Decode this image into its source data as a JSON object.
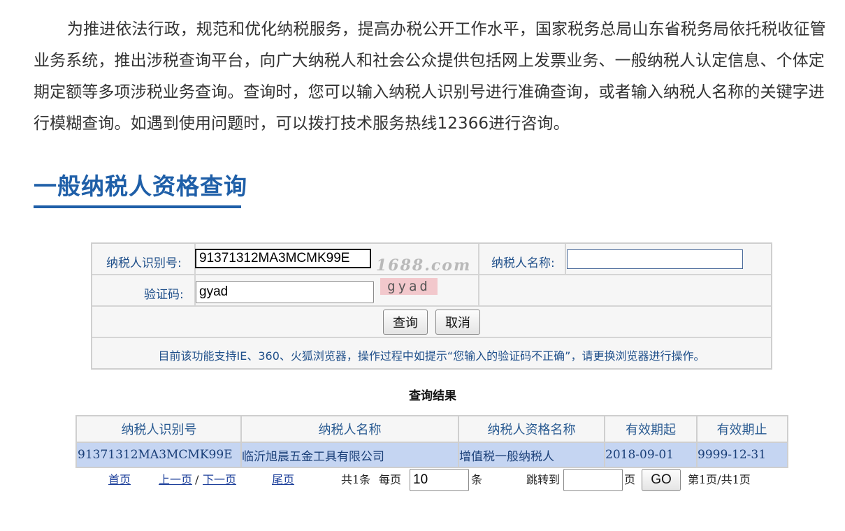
{
  "intro": {
    "paragraph": "为推进依法行政，规范和优化纳税服务，提高办税公开工作水平，国家税务总局山东省税务局依托税收征管业务系统，推出涉税查询平台，向广大纳税人和社会公众提供包括网上发票业务、一般纳税人认定信息、个体定期定额等多项涉税业务查询。查询时，您可以输入纳税人识别号进行准确查询，或者输入纳税人名称的关键字进行模糊查询。如遇到使用问题时，可以拨打技术服务热线12366进行咨询。"
  },
  "section": {
    "title": "一般纳税人资格查询"
  },
  "form": {
    "taxpayer_id_label": "纳税人识别号:",
    "taxpayer_id_value": "91371312MA3MCMK99E",
    "taxpayer_name_label": "纳税人名称:",
    "taxpayer_name_value": "",
    "captcha_label": "验证码:",
    "captcha_value": "gyad",
    "captcha_image_text": "gyad",
    "watermark": "1688.com",
    "query_button": "查询",
    "cancel_button": "取消",
    "notice": "目前该功能支持IE、360、火狐浏览器，操作过程中如提示“您输入的验证码不正确”，请更换浏览器进行操作。"
  },
  "results": {
    "title": "查询结果",
    "columns": [
      "纳税人识别号",
      "纳税人名称",
      "纳税人资格名称",
      "有效期起",
      "有效期止"
    ],
    "rows": [
      [
        "91371312MA3MCMK99E",
        "临沂旭晨五金工具有限公司",
        "增值税一般纳税人",
        "2018-09-01",
        "9999-12-31"
      ]
    ]
  },
  "pager": {
    "first": "首页",
    "prev": "上一页",
    "slash": "/",
    "next": "下一页",
    "last": "尾页",
    "total": "共1条",
    "per_page_label": "每页",
    "per_page_value": "10",
    "per_page_unit": "条",
    "jump_label": "跳转到",
    "jump_value": "",
    "page_unit": "页",
    "go_button": "GO",
    "page_info": "第1页/共1页"
  },
  "colors": {
    "title_blue": "#1f5fa8",
    "label_blue": "#1f4f8a",
    "result_row_bg": "#c5d5f2"
  }
}
